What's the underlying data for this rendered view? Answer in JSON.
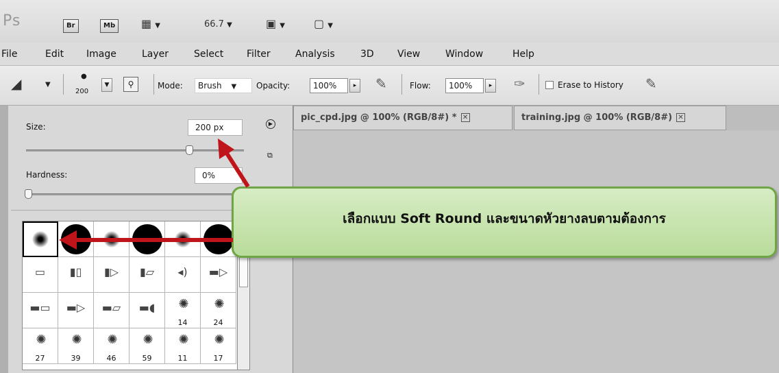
{
  "appbar": {
    "logo": "Ps",
    "bridge_label": "Br",
    "minibridge_label": "Mb",
    "zoom": "66.7",
    "dropdown_glyph": "▼"
  },
  "menu": [
    "File",
    "Edit",
    "Image",
    "Layer",
    "Select",
    "Filter",
    "Analysis",
    "3D",
    "View",
    "Window",
    "Help"
  ],
  "options": {
    "brush_size": "200",
    "mode_label": "Mode:",
    "mode_value": "Brush",
    "opacity_label": "Opacity:",
    "opacity_value": "100%",
    "flow_label": "Flow:",
    "flow_value": "100%",
    "erase_history_label": "Erase to History"
  },
  "tabs": [
    {
      "label": "pic_cpd.jpg @ 100% (RGB/8#) *"
    },
    {
      "label": "training.jpg @ 100% (RGB/8#)"
    }
  ],
  "brush_panel": {
    "size_label": "Size:",
    "size_value": "200 px",
    "hardness_label": "Hardness:",
    "hardness_value": "0%",
    "size_slider_fraction": 0.75,
    "hardness_slider_fraction": 0.0,
    "presets": [
      {
        "kind": "soft",
        "num": ""
      },
      {
        "kind": "hard",
        "num": ""
      },
      {
        "kind": "soft",
        "num": ""
      },
      {
        "kind": "hard",
        "num": ""
      },
      {
        "kind": "soft",
        "num": ""
      },
      {
        "kind": "hard",
        "num": ""
      },
      {
        "kind": "glyph",
        "num": ""
      },
      {
        "kind": "glyph",
        "num": ""
      },
      {
        "kind": "glyph",
        "num": ""
      },
      {
        "kind": "glyph",
        "num": ""
      },
      {
        "kind": "glyph",
        "num": ""
      },
      {
        "kind": "glyph",
        "num": ""
      },
      {
        "kind": "glyph",
        "num": ""
      },
      {
        "kind": "glyph",
        "num": ""
      },
      {
        "kind": "glyph",
        "num": ""
      },
      {
        "kind": "glyph",
        "num": ""
      },
      {
        "kind": "splat",
        "num": "14"
      },
      {
        "kind": "splat",
        "num": "24"
      },
      {
        "kind": "splat",
        "num": "27"
      },
      {
        "kind": "splat",
        "num": "39"
      },
      {
        "kind": "splat",
        "num": "46"
      },
      {
        "kind": "splat",
        "num": "59"
      },
      {
        "kind": "splat",
        "num": "11"
      },
      {
        "kind": "splat",
        "num": "17"
      }
    ]
  },
  "callout": {
    "text": "เลือกแบบ Soft Round และขนาดหัวยางลบตามต้องการ"
  },
  "colors": {
    "arrow": "#c0141b",
    "callout_border": "#6fa546",
    "callout_fill": "#c6e3ad"
  },
  "icons": {
    "eraser": "eraser-icon",
    "brush_panel_toggle": "brush-panel-icon",
    "airbrush": "airbrush-icon",
    "tablet_pressure": "tablet-pressure-icon",
    "panel_menu": "panel-menu-icon",
    "new_preset": "new-preset-icon"
  }
}
